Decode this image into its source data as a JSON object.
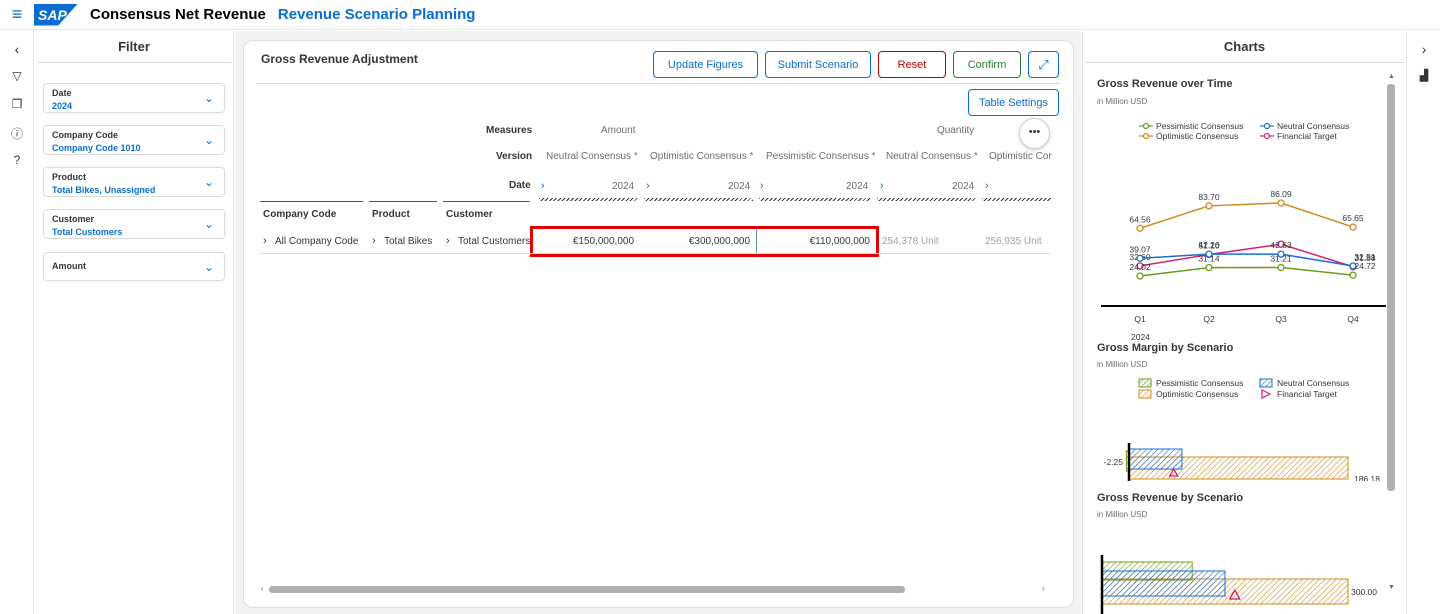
{
  "header": {
    "app_title": "Consensus Net Revenue",
    "story_title": "Revenue Scenario Planning",
    "logo": "SAP"
  },
  "filter": {
    "title": "Filter",
    "items": [
      {
        "label": "Date",
        "value": "2024"
      },
      {
        "label": "Company Code",
        "value": "Company Code 1010"
      },
      {
        "label": "Product",
        "value": "Total Bikes, Unassigned"
      },
      {
        "label": "Customer",
        "value": "Total Customers"
      },
      {
        "label": "Amount",
        "value": ""
      }
    ]
  },
  "panel": {
    "title": "Gross Revenue Adjustment",
    "buttons": {
      "update": "Update Figures",
      "submit": "Submit Scenario",
      "reset": "Reset",
      "confirm": "Confirm",
      "table_settings": "Table Settings"
    },
    "more_label": "•••"
  },
  "table": {
    "row_labels": {
      "measures": "Measures",
      "version": "Version",
      "date": "Date"
    },
    "measures": {
      "amount": "Amount",
      "quantity": "Quantity"
    },
    "versions": [
      "Neutral Consensus *",
      "Optimistic Consensus *",
      "Pessimistic Consensus *",
      "Neutral Consensus *",
      "Optimistic Cor"
    ],
    "dates": [
      "2024",
      "2024",
      "2024",
      "2024",
      ""
    ],
    "dim_headers": [
      "Company Code",
      "Product",
      "Customer"
    ],
    "row": {
      "company": "All Company Code",
      "product": "Total Bikes",
      "customer": "Total Customers",
      "values": [
        "€150,000,000",
        "€300,000,000",
        "€110,000,000",
        "254,378 Unit",
        "256,935 Unit"
      ]
    }
  },
  "charts": {
    "title": "Charts",
    "chart1_title": "Gross Revenue over Time",
    "chart1_unit": "in Million USD",
    "chart2_title": "Gross Margin by Scenario",
    "chart2_unit": "in Million USD",
    "chart3_title": "Gross Revenue by Scenario",
    "chart3_unit": "in Million USD",
    "legend": {
      "pess": "Pessimistic Consensus",
      "neut": "Neutral Consensus",
      "opt": "Optimistic Consensus",
      "fin": "Financial Target"
    },
    "year_label": "2024",
    "colors": {
      "pess": "#6a9c19",
      "neut": "#1b6ed1",
      "opt": "#d08a1b",
      "fin": "#d0207a"
    }
  },
  "chart_data": [
    {
      "type": "line",
      "title": "Gross Revenue over Time",
      "subtitle": "in Million USD",
      "categories": [
        "Q1",
        "Q2",
        "Q3",
        "Q4"
      ],
      "series": [
        {
          "name": "Optimistic Consensus",
          "values": [
            64.56,
            83.7,
            86.09,
            65.65
          ]
        },
        {
          "name": "Financial Target",
          "values": [
            32.6,
            42.26,
            51.1,
            31.88
          ]
        },
        {
          "name": "Neutral Consensus",
          "values": [
            39.07,
            42.63,
            42.63,
            32.51
          ]
        },
        {
          "name": "Pessimistic Consensus",
          "values": [
            24.02,
            31.14,
            31.21,
            24.72
          ]
        }
      ],
      "value_labels": [
        [
          "64.56",
          "83.70",
          "86.09",
          "65.65"
        ],
        [
          "32.60",
          "51.10",
          "",
          "31.88"
        ],
        [
          "39.07",
          "42.26",
          "42.63",
          "32.51"
        ],
        [
          "24.02",
          "31.14",
          "31.21",
          "24.72"
        ]
      ],
      "ylim": [
        0,
        100
      ],
      "legend": "top"
    },
    {
      "type": "bar",
      "title": "Gross Margin by Scenario",
      "subtitle": "in Million USD",
      "series": [
        {
          "name": "Pessimistic Consensus",
          "values": [
            -2.25
          ]
        },
        {
          "name": "Neutral Consensus",
          "values": [
            45
          ]
        },
        {
          "name": "Optimistic Consensus",
          "values": [
            186.18
          ]
        },
        {
          "name": "Financial Target",
          "values": [
            38
          ]
        }
      ],
      "value_labels": [
        "-2.25",
        "",
        "186.18",
        ""
      ],
      "xlim": [
        -5,
        200
      ]
    },
    {
      "type": "bar",
      "title": "Gross Revenue by Scenario",
      "subtitle": "in Million USD",
      "series": [
        {
          "name": "Pessimistic Consensus",
          "values": [
            110
          ]
        },
        {
          "name": "Neutral Consensus",
          "values": [
            150
          ]
        },
        {
          "name": "Optimistic Consensus",
          "values": [
            300.0
          ]
        },
        {
          "name": "Financial Target",
          "values": [
            162
          ]
        }
      ],
      "value_labels": [
        "",
        "",
        "300.00",
        ""
      ],
      "xlim": [
        0,
        300
      ]
    }
  ]
}
